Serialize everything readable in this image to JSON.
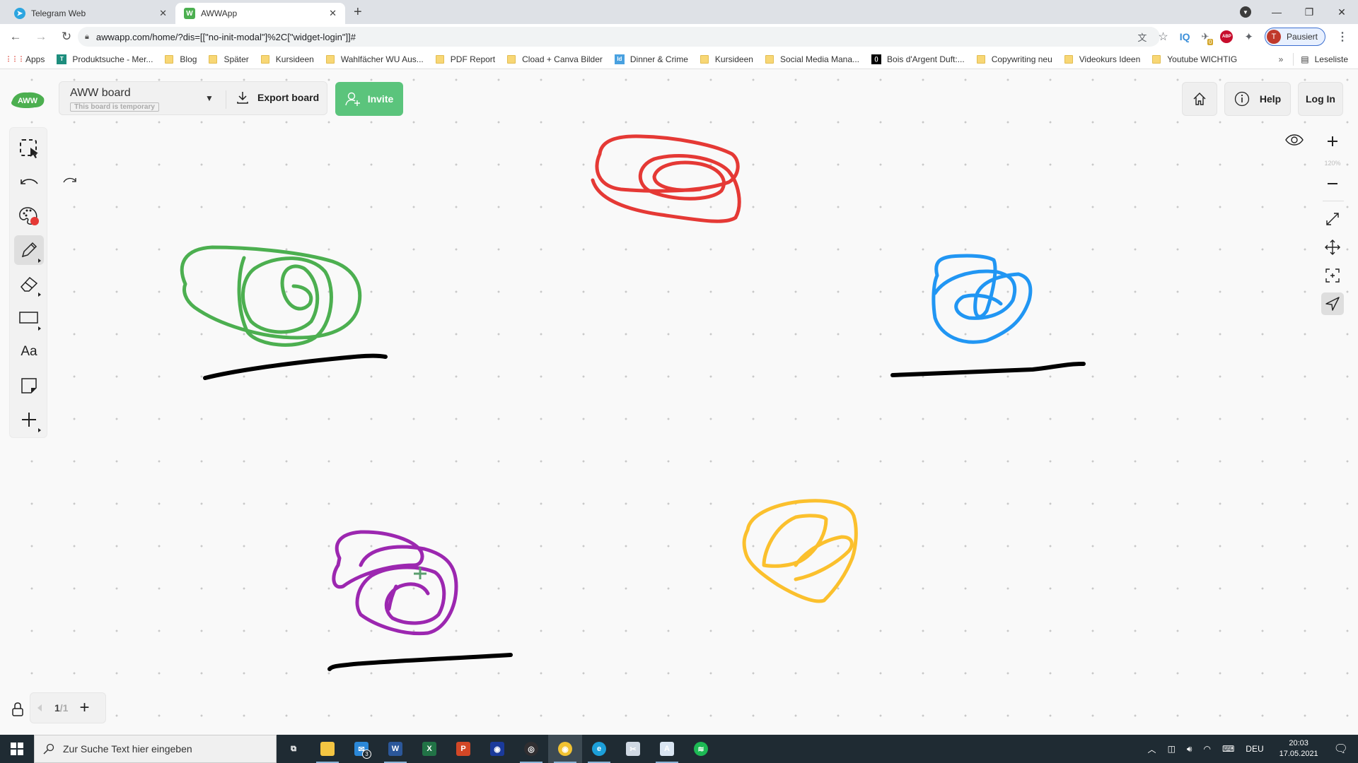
{
  "browser": {
    "tabs": [
      {
        "title": "Telegram Web",
        "icon": "telegram-icon",
        "active": false
      },
      {
        "title": "AWWApp",
        "icon": "awwapp-icon",
        "active": true
      }
    ],
    "url": "awwapp.com/home/?dis=[[\"no-init-modal\"]%2C[\"widget-login\"]]#",
    "profile": {
      "initial": "T",
      "status": "Pausiert"
    },
    "extension_badge": "0",
    "bookmarks": [
      {
        "label": "Apps",
        "icon": "apps-grid-icon"
      },
      {
        "label": "Produktsuche - Mer...",
        "icon": "shirt-icon"
      },
      {
        "label": "Blog",
        "icon": "folder-icon"
      },
      {
        "label": "Später",
        "icon": "folder-icon"
      },
      {
        "label": "Kursideen",
        "icon": "folder-icon"
      },
      {
        "label": "Wahlfächer WU Aus...",
        "icon": "folder-icon"
      },
      {
        "label": "PDF Report",
        "icon": "folder-icon"
      },
      {
        "label": "Cload + Canva Bilder",
        "icon": "folder-icon"
      },
      {
        "label": "Dinner & Crime",
        "icon": "indesign-icon"
      },
      {
        "label": "Kursideen",
        "icon": "folder-icon"
      },
      {
        "label": "Social Media Mana...",
        "icon": "folder-icon"
      },
      {
        "label": "Bois d'Argent Duft:...",
        "icon": "dior-icon"
      },
      {
        "label": "Copywriting neu",
        "icon": "folder-icon"
      },
      {
        "label": "Videokurs Ideen",
        "icon": "folder-icon"
      },
      {
        "label": "Youtube WICHTIG",
        "icon": "folder-icon"
      }
    ],
    "bookmarks_overflow": "»",
    "reading_list": "Leseliste"
  },
  "app": {
    "logo_text": "AWW",
    "board": {
      "name": "AWW board",
      "temporary_label": "This board is temporary"
    },
    "export_label": "Export board",
    "invite_label": "Invite",
    "help_label": "Help",
    "login_label": "Log In",
    "zoom_level": "120%",
    "page": {
      "current": "1",
      "total": "/1"
    },
    "tools": [
      {
        "name": "select",
        "icon": "select-icon",
        "active": false
      },
      {
        "name": "undo",
        "icon": "undo-icon",
        "active": false
      },
      {
        "name": "color",
        "icon": "palette-icon",
        "active": false,
        "color": "#e53935"
      },
      {
        "name": "pen",
        "icon": "pencil-icon",
        "active": true
      },
      {
        "name": "eraser",
        "icon": "eraser-icon",
        "active": false
      },
      {
        "name": "shape",
        "icon": "rectangle-icon",
        "active": false
      },
      {
        "name": "text",
        "icon": "text-icon",
        "active": false,
        "label": "Aa"
      },
      {
        "name": "sticky-note",
        "icon": "sticky-note-icon",
        "active": false
      },
      {
        "name": "add",
        "icon": "plus-icon",
        "active": false
      }
    ],
    "strokes": [
      {
        "name": "red-scribble",
        "color": "#e53935"
      },
      {
        "name": "green-scribble",
        "color": "#4caf50"
      },
      {
        "name": "blue-scribble",
        "color": "#2196f3"
      },
      {
        "name": "purple-scribble",
        "color": "#9c27b0"
      },
      {
        "name": "yellow-scribble",
        "color": "#fbc02d"
      },
      {
        "name": "black-underline-1",
        "color": "#000000"
      },
      {
        "name": "black-underline-2",
        "color": "#000000"
      },
      {
        "name": "black-underline-3",
        "color": "#000000"
      }
    ],
    "accent_color": "#5bc47c"
  },
  "taskbar": {
    "search_placeholder": "Zur Suche Text hier eingeben",
    "apps": [
      {
        "name": "task-view",
        "running": false
      },
      {
        "name": "file-explorer",
        "running": true
      },
      {
        "name": "mail",
        "running": false,
        "badge": "3"
      },
      {
        "name": "word",
        "running": true
      },
      {
        "name": "excel",
        "running": false
      },
      {
        "name": "powerpoint",
        "running": false
      },
      {
        "name": "audacity",
        "running": false
      },
      {
        "name": "obs",
        "running": true
      },
      {
        "name": "chrome",
        "running": true,
        "active": true
      },
      {
        "name": "edge",
        "running": true
      },
      {
        "name": "snipping-tool",
        "running": false
      },
      {
        "name": "wordpad",
        "running": true
      },
      {
        "name": "spotify",
        "running": false
      }
    ],
    "language": "DEU",
    "time": "20:03",
    "date": "17.05.2021"
  }
}
